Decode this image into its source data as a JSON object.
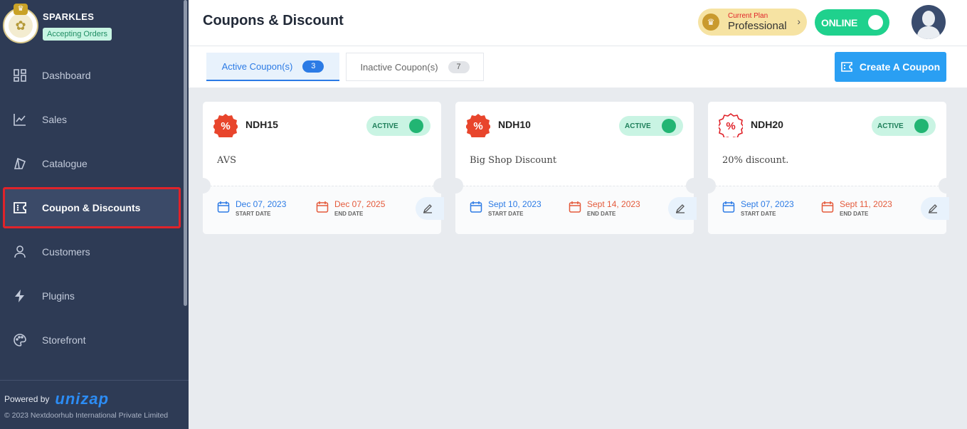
{
  "store": {
    "name": "SPARKLES",
    "status_badge": "Accepting Orders"
  },
  "sidebar": {
    "items": [
      {
        "label": "Dashboard",
        "icon": "dashboard-icon"
      },
      {
        "label": "Sales",
        "icon": "chart-line-icon"
      },
      {
        "label": "Catalogue",
        "icon": "catalogue-icon"
      },
      {
        "label": "Coupon & Discounts",
        "icon": "coupon-icon",
        "active": true
      },
      {
        "label": "Customers",
        "icon": "user-icon"
      },
      {
        "label": "Plugins",
        "icon": "bolt-icon"
      },
      {
        "label": "Storefront",
        "icon": "palette-icon"
      }
    ],
    "powered_by": "Powered by",
    "powered_brand": "unizap",
    "copyright": "© 2023 Nextdoorhub International Private Limited"
  },
  "header": {
    "title": "Coupons & Discount",
    "plan_label": "Current Plan",
    "plan_value": "Professional",
    "online_label": "ONLINE"
  },
  "tabs": [
    {
      "label": "Active Coupon(s)",
      "count": "3",
      "selected": true
    },
    {
      "label": "Inactive Coupon(s)",
      "count": "7",
      "selected": false
    }
  ],
  "create_button": "Create A Coupon",
  "coupons": [
    {
      "code": "NDH15",
      "status": "ACTIVE",
      "description": "AVS",
      "start_date": "Dec 07, 2023",
      "start_label": "START DATE",
      "end_date": "Dec 07, 2025",
      "end_label": "END DATE",
      "icon_style": "filled"
    },
    {
      "code": "NDH10",
      "status": "ACTIVE",
      "description": "Big Shop Discount",
      "start_date": "Sept 10, 2023",
      "start_label": "START DATE",
      "end_date": "Sept 14, 2023",
      "end_label": "END DATE",
      "icon_style": "filled"
    },
    {
      "code": "NDH20",
      "status": "ACTIVE",
      "description": "20% discount.",
      "start_date": "Sept 07, 2023",
      "start_label": "START DATE",
      "end_date": "Sept 11, 2023",
      "end_label": "END DATE",
      "icon_style": "outline"
    }
  ],
  "colors": {
    "sidebar_bg": "#2e3b55",
    "accent_blue": "#2a9ff3",
    "online_green": "#1fd18d",
    "active_toggle": "#22b573",
    "end_date_red": "#e45a3b",
    "highlight_border": "#e0232a"
  }
}
